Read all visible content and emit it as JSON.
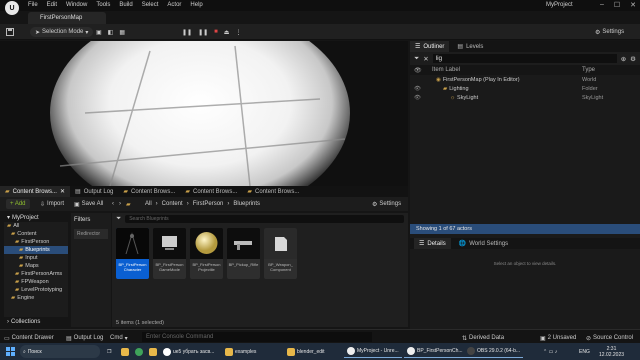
{
  "app": {
    "logo": "U",
    "menu": [
      "File",
      "Edit",
      "Window",
      "Tools",
      "Build",
      "Select",
      "Actor",
      "Help"
    ],
    "project_name": "MyProject",
    "window_controls": [
      "–",
      "☐",
      "✕"
    ],
    "map_tab": "FirstPersonMap"
  },
  "toolbar": {
    "mode": "Selection Mode",
    "settings": "Settings",
    "play_controls": [
      "pause-icon",
      "pause-icon",
      "stop-icon",
      "eject-icon"
    ]
  },
  "outliner": {
    "tab_outliner": "Outliner",
    "tab_levels": "Levels",
    "search_value": "lig",
    "col_label": "Item Label",
    "col_type": "Type",
    "rows": [
      {
        "label": "FirstPersonMap (Play In Editor)",
        "type": "World",
        "indent": 0
      },
      {
        "label": "Lighting",
        "type": "Folder",
        "indent": 1
      },
      {
        "label": "SkyLight",
        "type": "SkyLight",
        "indent": 2
      }
    ],
    "count": "Showing 1 of 67 actors"
  },
  "details": {
    "tab_details": "Details",
    "tab_world": "World Settings",
    "empty": "Select an object to view details."
  },
  "content_tabs": [
    "Content Brows...",
    "Output Log",
    "Content Brows...",
    "Content Brows...",
    "Content Brows..."
  ],
  "content_browser": {
    "add": "+ Add",
    "import": "Import",
    "save_all": "Save All",
    "breadcrumb": [
      "All",
      "Content",
      "FirstPerson",
      "Blueprints"
    ],
    "settings": "Settings",
    "search_placeholder": "Search Blueprints",
    "filters_title": "Filters",
    "filter_chip": "Redirector",
    "tree_root": "MyProject",
    "tree": [
      {
        "label": "All",
        "indent": 0
      },
      {
        "label": "Content",
        "indent": 1
      },
      {
        "label": "FirstPerson",
        "indent": 2
      },
      {
        "label": "Blueprints",
        "indent": 3,
        "selected": true
      },
      {
        "label": "Input",
        "indent": 3
      },
      {
        "label": "Maps",
        "indent": 3
      },
      {
        "label": "FirstPersonArms",
        "indent": 2
      },
      {
        "label": "FPWeapon",
        "indent": 2
      },
      {
        "label": "LevelPrototyping",
        "indent": 2
      },
      {
        "label": "Engine",
        "indent": 1
      }
    ],
    "collections": "Collections",
    "assets": [
      {
        "label": "BP_FirstPerson Character",
        "thumb": "character",
        "selected": true
      },
      {
        "label": "BP_FirstPerson GameMode",
        "thumb": "gamemode"
      },
      {
        "label": "BP_FirstPerson Projectile",
        "thumb": "sphere"
      },
      {
        "label": "BP_Pickup_Rifle",
        "thumb": "rifle"
      },
      {
        "label": "BP_Weapon_ Component",
        "thumb": "component"
      }
    ],
    "status": "5 items (1 selected)"
  },
  "statusbar": {
    "content_drawer": "Content Drawer",
    "output_log": "Output Log",
    "cmd": "Cmd",
    "console_placeholder": "Enter Console Command",
    "derived_data": "Derived Data",
    "unsaved": "2 Unsaved",
    "source_control": "Source Control"
  },
  "taskbar": {
    "search": "Поиск",
    "items": [
      "ue5 убрать засв...",
      "examples",
      "blender_edit",
      "MyProject - Unre...",
      "BP_FirstPersonCh...",
      "OBS 29.0.2 (64-b..."
    ],
    "lang": "ENG",
    "time": "2:31",
    "date": "12.02.2023"
  },
  "colors": {
    "accent_blue": "#0a5fd1",
    "folder_yellow": "#c9a04a",
    "highlight_green": "#8fbf2e"
  }
}
